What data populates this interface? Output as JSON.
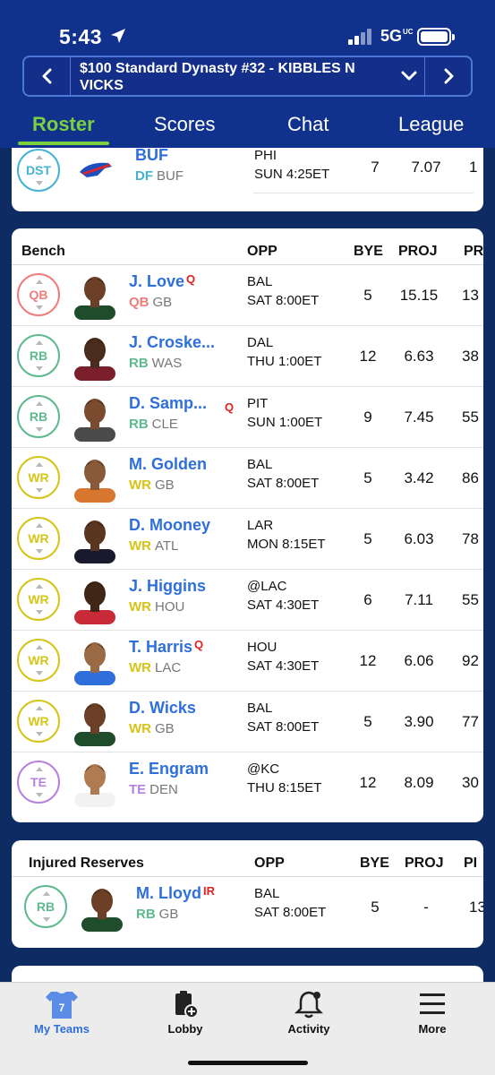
{
  "status": {
    "time": "5:43",
    "network": "5G",
    "network_sup": "UC"
  },
  "selector": {
    "title": "$100 Standard Dynasty #32 - KIBBLES N VICKS",
    "prev_label": "‹",
    "next_label": "›"
  },
  "tabs": [
    {
      "label": "Roster",
      "active": true
    },
    {
      "label": "Scores",
      "active": false
    },
    {
      "label": "Chat",
      "active": false
    },
    {
      "label": "League",
      "active": false
    }
  ],
  "starter_dst": {
    "pos": "DST",
    "name": "BUF",
    "pos_label": "DF",
    "team": "BUF",
    "opp": "PHI",
    "time": "SUN 4:25ET",
    "bye": "7",
    "proj": "7.07",
    "pr": "1"
  },
  "bench": {
    "title": "Bench",
    "columns": {
      "opp": "OPP",
      "bye": "BYE",
      "proj": "PROJ",
      "pr": "PR"
    },
    "players": [
      {
        "pos": "QB",
        "name": "J. Love",
        "flag": "Q",
        "team": "GB",
        "opp": "BAL",
        "time": "SAT 8:00ET",
        "bye": "5",
        "proj": "15.15",
        "pr": "13"
      },
      {
        "pos": "RB",
        "name": "J. Croske...",
        "flag": "",
        "team": "WAS",
        "opp": "DAL",
        "time": "THU 1:00ET",
        "bye": "12",
        "proj": "6.63",
        "pr": "38"
      },
      {
        "pos": "RB",
        "name": "D. Samp...",
        "flag": "Q",
        "team": "CLE",
        "opp": "PIT",
        "time": "SUN 1:00ET",
        "bye": "9",
        "proj": "7.45",
        "pr": "55"
      },
      {
        "pos": "WR",
        "name": "M. Golden",
        "flag": "",
        "team": "GB",
        "opp": "BAL",
        "time": "SAT 8:00ET",
        "bye": "5",
        "proj": "3.42",
        "pr": "86"
      },
      {
        "pos": "WR",
        "name": "D. Mooney",
        "flag": "",
        "team": "ATL",
        "opp": "LAR",
        "time": "MON 8:15ET",
        "bye": "5",
        "proj": "6.03",
        "pr": "78"
      },
      {
        "pos": "WR",
        "name": "J. Higgins",
        "flag": "",
        "team": "HOU",
        "opp": "@LAC",
        "time": "SAT 4:30ET",
        "bye": "6",
        "proj": "7.11",
        "pr": "55"
      },
      {
        "pos": "WR",
        "name": "T. Harris",
        "flag": "Q",
        "team": "LAC",
        "opp": "HOU",
        "time": "SAT 4:30ET",
        "bye": "12",
        "proj": "6.06",
        "pr": "92"
      },
      {
        "pos": "WR",
        "name": "D. Wicks",
        "flag": "",
        "team": "GB",
        "opp": "BAL",
        "time": "SAT 8:00ET",
        "bye": "5",
        "proj": "3.90",
        "pr": "77"
      },
      {
        "pos": "TE",
        "name": "E. Engram",
        "flag": "",
        "team": "DEN",
        "opp": "@KC",
        "time": "THU 8:15ET",
        "bye": "12",
        "proj": "8.09",
        "pr": "30"
      }
    ]
  },
  "injured": {
    "title": "Injured Reserves",
    "columns": {
      "opp": "OPP",
      "bye": "BYE",
      "proj": "PROJ",
      "pr": "PI"
    },
    "players": [
      {
        "pos": "RB",
        "name": "M. Lloyd",
        "flag": "IR",
        "team": "GB",
        "opp": "BAL",
        "time": "SAT 8:00ET",
        "bye": "5",
        "proj": "-",
        "pr": "13"
      }
    ]
  },
  "tabbar": [
    {
      "label": "My Teams",
      "icon": "jersey-icon",
      "badge": "7",
      "active": true
    },
    {
      "label": "Lobby",
      "icon": "clipboard-plus-icon",
      "active": false
    },
    {
      "label": "Activity",
      "icon": "bell-icon",
      "active": false
    },
    {
      "label": "More",
      "icon": "menu-icon",
      "active": false
    }
  ],
  "colors": {
    "header": "#10318c",
    "accent": "#7ccf3f",
    "link": "#2f6fdc",
    "qb": "#ef7d7d",
    "rb": "#5fb98f",
    "wr": "#d6c417",
    "te": "#b681e0",
    "dst": "#45b2d2",
    "flag": "#e02222"
  }
}
